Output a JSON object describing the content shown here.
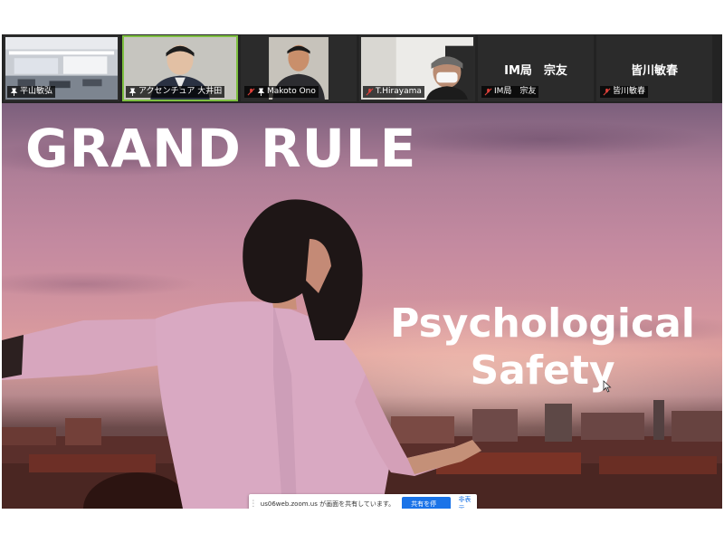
{
  "participants": [
    {
      "name": "平山敏弘",
      "muted": false
    },
    {
      "name": "アクセンチュア 大井田",
      "muted": false,
      "active": true
    },
    {
      "name": "Makoto Ono",
      "muted": true
    },
    {
      "name": "T.Hirayama",
      "muted": true
    },
    {
      "name": "IM局　宗友",
      "display_name": "IM局　宗友",
      "muted": true
    },
    {
      "name": "皆川敏春",
      "display_name": "皆川敏春",
      "muted": true
    }
  ],
  "slide": {
    "title": "GRAND RULE",
    "subtitle_line1": "Psychological",
    "subtitle_line2": "Safety"
  },
  "share_bar": {
    "message": "us06web.zoom.us が画面を共有しています。",
    "stop_label": "共有を停止",
    "hide_label": "非表示"
  },
  "colors": {
    "active_border": "#7ec040",
    "stop_button": "#1a73e8",
    "muted_mic": "#e0413a"
  }
}
